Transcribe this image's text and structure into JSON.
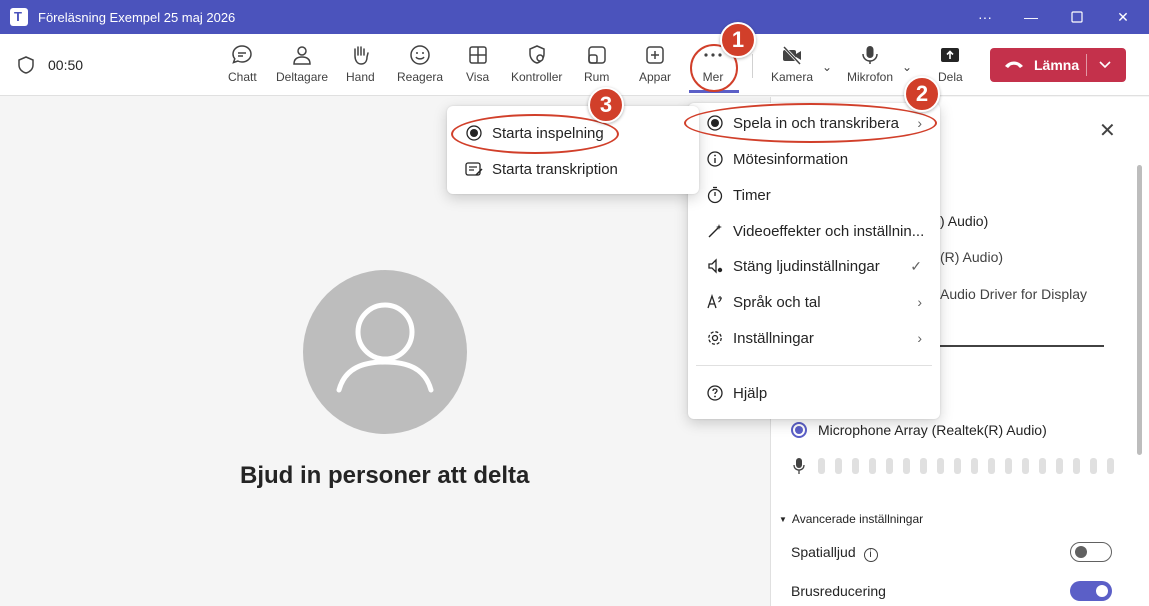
{
  "window": {
    "title": "Föreläsning Exempel 25 maj 2026",
    "controls": [
      "more-icon",
      "minimize-icon",
      "maximize-icon",
      "close-icon"
    ]
  },
  "toolbar": {
    "timer": "00:50",
    "items": [
      {
        "label": "Chatt",
        "icon": "chat-icon"
      },
      {
        "label": "Deltagare",
        "icon": "people-icon"
      },
      {
        "label": "Hand",
        "icon": "hand-icon"
      },
      {
        "label": "Reagera",
        "icon": "smiley-icon"
      },
      {
        "label": "Visa",
        "icon": "grid-icon"
      },
      {
        "label": "Kontroller",
        "icon": "shield-gear-icon"
      },
      {
        "label": "Rum",
        "icon": "rooms-icon"
      },
      {
        "label": "Appar",
        "icon": "plus-square-icon"
      },
      {
        "label": "Mer",
        "icon": "more-icon"
      },
      {
        "label": "Kamera",
        "icon": "camera-off-icon"
      },
      {
        "label": "Mikrofon",
        "icon": "mic-icon"
      },
      {
        "label": "Dela",
        "icon": "share-icon"
      }
    ],
    "leave_label": "Lämna"
  },
  "stage": {
    "invite_text": "Bjud in personer att delta"
  },
  "panel": {
    "device_lines": [
      ") Audio)",
      "(R) Audio)",
      "Audio Driver for Display"
    ],
    "microphone": "Microphone Array (Realtek(R) Audio)",
    "advanced": "Avancerade inställningar",
    "spatial": "Spatialljud",
    "noise": "Brusreducering",
    "spatial_on": false,
    "noise_on": true
  },
  "more_menu": {
    "items": [
      {
        "label": "Spela in och transkribera",
        "icon": "record-icon",
        "right": "›"
      },
      {
        "label": "Mötesinformation",
        "icon": "info-icon",
        "right": ""
      },
      {
        "label": "Timer",
        "icon": "timer-icon",
        "right": ""
      },
      {
        "label": "Videoeffekter och inställnin...",
        "icon": "video-effects-icon",
        "right": ""
      },
      {
        "label": "Stäng ljudinställningar",
        "icon": "speaker-settings-icon",
        "right": "✓"
      },
      {
        "label": "Språk och tal",
        "icon": "language-icon",
        "right": "›"
      },
      {
        "label": "Inställningar",
        "icon": "settings-icon",
        "right": "›"
      },
      {
        "label": "Hjälp",
        "icon": "help-icon",
        "right": ""
      }
    ]
  },
  "record_submenu": {
    "items": [
      {
        "label": "Starta inspelning",
        "icon": "record-icon"
      },
      {
        "label": "Starta transkription",
        "icon": "transcript-icon"
      }
    ]
  },
  "callouts": [
    "1",
    "2",
    "3"
  ],
  "colors": {
    "titlebar": "#4b53bc",
    "accent": "#5b5fc7",
    "leave": "#c4314b",
    "callout": "#d13f2a"
  }
}
